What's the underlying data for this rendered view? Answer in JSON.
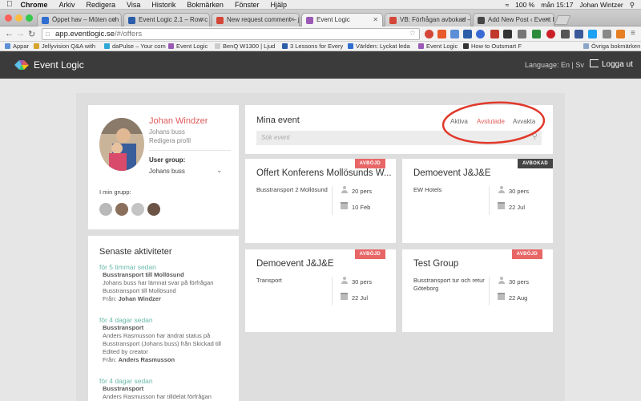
{
  "os_menubar": {
    "app": "Chrome",
    "menus": [
      "Arkiv",
      "Redigera",
      "Visa",
      "Historik",
      "Bokmärken",
      "Fönster",
      "Hjälp"
    ],
    "battery": "100 %",
    "clock": "mån 15:17",
    "user": "Johan Wintzer"
  },
  "browser": {
    "tabs": [
      {
        "label": "Öppet hav – Möten och ko",
        "favicon_color": "#2f6dd0"
      },
      {
        "label": "Event Logic 2.1 – Row c",
        "favicon_color": "#2b5da8"
      },
      {
        "label": "New request comment – ju",
        "favicon_color": "#d44638"
      },
      {
        "label": "Event Logic",
        "favicon_color": "#9b59b6"
      },
      {
        "label": "VB: Förfrågan avbokad – ja",
        "favicon_color": "#d44638"
      },
      {
        "label": "Add New Post ‹ Event Logi",
        "favicon_color": "#464646"
      }
    ],
    "url_host": "app.eventlogic.se",
    "url_path": "/#/offers",
    "bookmarks": [
      {
        "label": "Appar",
        "color": "#5c8fd6"
      },
      {
        "label": "Jellyvision Q&A with",
        "color": "#d6a52c"
      },
      {
        "label": "daPulse – Your com",
        "color": "#2ea8d6"
      },
      {
        "label": "Event Logic",
        "color": "#9b59b6"
      },
      {
        "label": "BenQ W1300 | Ljud",
        "color": "#cccccc"
      },
      {
        "label": "3 Lessons for Every",
        "color": "#2b5da8"
      },
      {
        "label": "Världen: Lyckat leda",
        "color": "#2f6dd0"
      },
      {
        "label": "Event Logic",
        "color": "#9b59b6"
      },
      {
        "label": "How to Outsmart F",
        "color": "#333333"
      },
      {
        "label": "Övriga bokmärken",
        "color": "#8aa6c8"
      }
    ]
  },
  "app_header": {
    "brand": "Event Logic",
    "language_label": "Language: En | Sv",
    "logout_label": "Logga ut"
  },
  "profile": {
    "name": "Johan Windzer",
    "company": "Johans buss",
    "edit_link": "Redigera profil",
    "user_group_label": "User group:",
    "user_group_value": "Johans buss",
    "my_group_label": "I min grupp:"
  },
  "events_panel": {
    "title": "Mina event",
    "tabs": {
      "active": "Aktiva",
      "finished": "Avslutade",
      "pending": "Avvakta"
    },
    "search_placeholder": "Sök event"
  },
  "events": [
    {
      "title": "Offert Konferens Mollösunds W...",
      "desc": "Busstransport 2 Mollösund",
      "people": "20 pers",
      "date": "10 Feb",
      "badge": "AVBÖJD",
      "badge_color": "#e86666"
    },
    {
      "title": "Demoevent J&J&E",
      "desc": "EW Hotels",
      "people": "30 pers",
      "date": "22 Jul",
      "badge": "AVBOKAD",
      "badge_color": "#444444"
    },
    {
      "title": "Demoevent J&J&E",
      "desc": "Transport",
      "people": "30 pers",
      "date": "22 Jul",
      "badge": "AVBÖJD",
      "badge_color": "#e86666"
    },
    {
      "title": "Test Group",
      "desc": "Busstransport tur och retur Göteborg",
      "people": "30 pers",
      "date": "22 Aug",
      "badge": "AVBÖJD",
      "badge_color": "#e86666"
    }
  ],
  "activities": {
    "title": "Senaste aktiviteter",
    "items": [
      {
        "time": "för 5 timmar sedan",
        "heading": "Busstransport till Mollösund",
        "lines": [
          "Johans buss har lämnat svar på förfrågan",
          "Busstransport till Mollösund"
        ],
        "from_label": "Från:",
        "from": "Johan Windzer"
      },
      {
        "time": "för 4 dagar sedan",
        "heading": "Busstransport",
        "lines": [
          "Anders Rasmusson har ändrat status på",
          "Busstransport (Johans buss) från Skickad till",
          "Edited by creator"
        ],
        "from_label": "Från:",
        "from": "Anders Rasmusson"
      },
      {
        "time": "för 4 dagar sedan",
        "heading": "Busstransport",
        "lines": [
          "Anders Rasmusson har tilldelat förfrågan"
        ],
        "from_label": "",
        "from": ""
      }
    ]
  },
  "colors": {
    "accent": "#e05a5a",
    "teal": "#6ab9a9",
    "header_bg": "#3b3b3b",
    "annotation": "#e0392b"
  }
}
